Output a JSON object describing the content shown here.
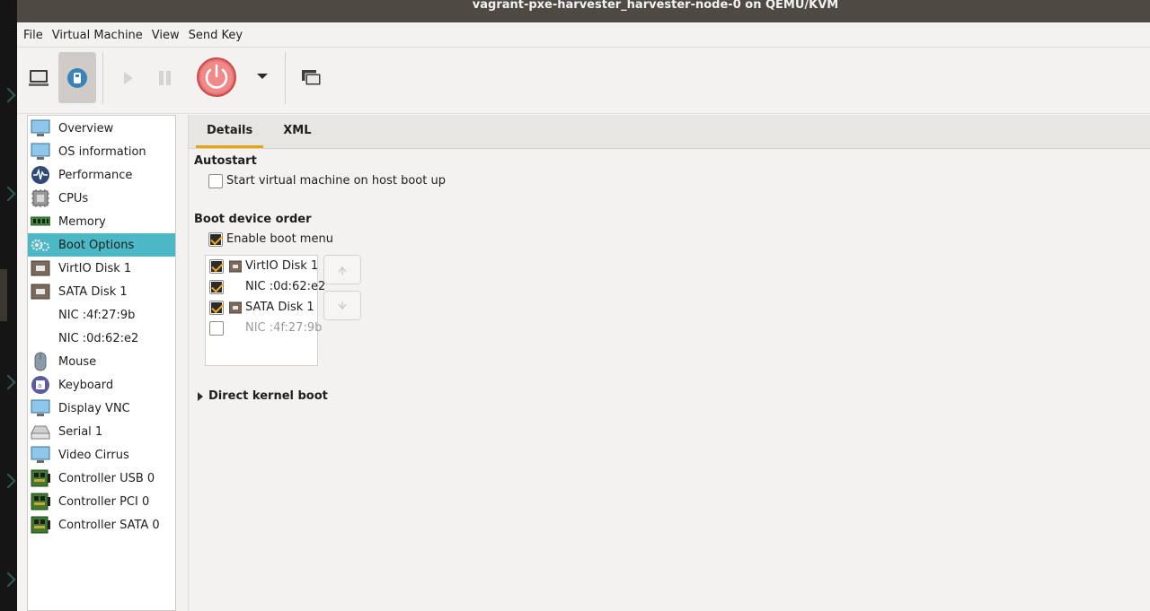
{
  "window": {
    "title": "vagrant-pxe-harvester_harvester-node-0 on QEMU/KVM"
  },
  "menubar": {
    "items": [
      "File",
      "Virtual Machine",
      "View",
      "Send Key"
    ]
  },
  "toolbar": {
    "console_icon": "monitor-icon",
    "details_icon": "info-bulb-icon",
    "run_icon": "play-icon",
    "pause_icon": "pause-icon",
    "power_icon": "power-icon",
    "power_color": "#e06666",
    "snapshot_icon": "snapshot-icon"
  },
  "sidebar": {
    "selected_index": 5,
    "accent": "#4cb8c6",
    "items": [
      {
        "label": "Overview",
        "icon": "monitor-icon"
      },
      {
        "label": "OS information",
        "icon": "monitor-icon"
      },
      {
        "label": "Performance",
        "icon": "waveform-icon"
      },
      {
        "label": "CPUs",
        "icon": "cpu-icon"
      },
      {
        "label": "Memory",
        "icon": "memory-icon"
      },
      {
        "label": "Boot Options",
        "icon": "gears-icon"
      },
      {
        "label": "VirtIO Disk 1",
        "icon": "disk-icon"
      },
      {
        "label": "SATA Disk 1",
        "icon": "disk-icon"
      },
      {
        "label": "NIC :4f:27:9b",
        "icon": "network-icon"
      },
      {
        "label": "NIC :0d:62:e2",
        "icon": "network-icon"
      },
      {
        "label": "Mouse",
        "icon": "mouse-icon"
      },
      {
        "label": "Keyboard",
        "icon": "keyboard-icon"
      },
      {
        "label": "Display VNC",
        "icon": "monitor-icon"
      },
      {
        "label": "Serial 1",
        "icon": "serial-icon"
      },
      {
        "label": "Video Cirrus",
        "icon": "monitor-icon"
      },
      {
        "label": "Controller USB 0",
        "icon": "controller-icon"
      },
      {
        "label": "Controller PCI 0",
        "icon": "controller-icon"
      },
      {
        "label": "Controller SATA 0",
        "icon": "controller-icon"
      }
    ]
  },
  "tabs": [
    {
      "label": "Details",
      "active": true
    },
    {
      "label": "XML",
      "active": false
    }
  ],
  "autostart": {
    "title": "Autostart",
    "checkbox_label": "Start virtual machine on host boot up",
    "checked": false
  },
  "boot": {
    "title": "Boot device order",
    "enable_menu_label": "Enable boot menu",
    "enable_menu_checked": true,
    "devices": [
      {
        "label": "VirtIO Disk 1",
        "checked": true,
        "icon": "disk-icon"
      },
      {
        "label": "NIC :0d:62:e2",
        "checked": true,
        "icon": ""
      },
      {
        "label": "SATA Disk 1",
        "checked": true,
        "icon": "disk-icon"
      },
      {
        "label": "NIC :4f:27:9b",
        "checked": false,
        "icon": ""
      }
    ],
    "move_up_icon": "arrow-up-icon",
    "move_down_icon": "arrow-down-icon"
  },
  "kernel": {
    "label": "Direct kernel boot"
  },
  "colors": {
    "checkbox_accent": "#f5a623",
    "tab_underline": "#e5a50a"
  }
}
